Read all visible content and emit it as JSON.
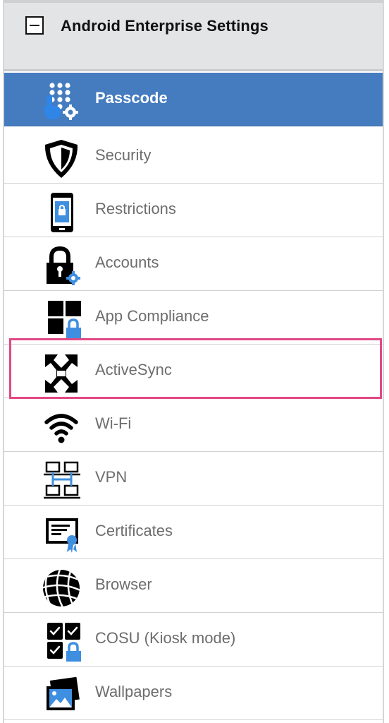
{
  "header": {
    "title": "Android Enterprise Settings"
  },
  "menu": {
    "items": [
      {
        "label": "Passcode",
        "icon": "passcode-icon",
        "selected": true
      },
      {
        "label": "Security",
        "icon": "shield-icon",
        "selected": false
      },
      {
        "label": "Restrictions",
        "icon": "phone-lock-icon",
        "selected": false
      },
      {
        "label": "Accounts",
        "icon": "lock-gear-icon",
        "selected": false
      },
      {
        "label": "App Compliance",
        "icon": "apps-lock-icon",
        "selected": false
      },
      {
        "label": "ActiveSync",
        "icon": "exchange-icon",
        "selected": false
      },
      {
        "label": "Wi-Fi",
        "icon": "wifi-icon",
        "selected": false
      },
      {
        "label": "VPN",
        "icon": "network-icon",
        "selected": false
      },
      {
        "label": "Certificates",
        "icon": "certificate-icon",
        "selected": false
      },
      {
        "label": "Browser",
        "icon": "globe-icon",
        "selected": false
      },
      {
        "label": "COSU (Kiosk mode)",
        "icon": "kiosk-icon",
        "selected": false
      },
      {
        "label": "Wallpapers",
        "icon": "image-icon",
        "selected": false
      }
    ]
  },
  "colors": {
    "selected_bg": "#457bbf",
    "highlight": "#e14886",
    "accent_blue": "#4a90d9"
  }
}
